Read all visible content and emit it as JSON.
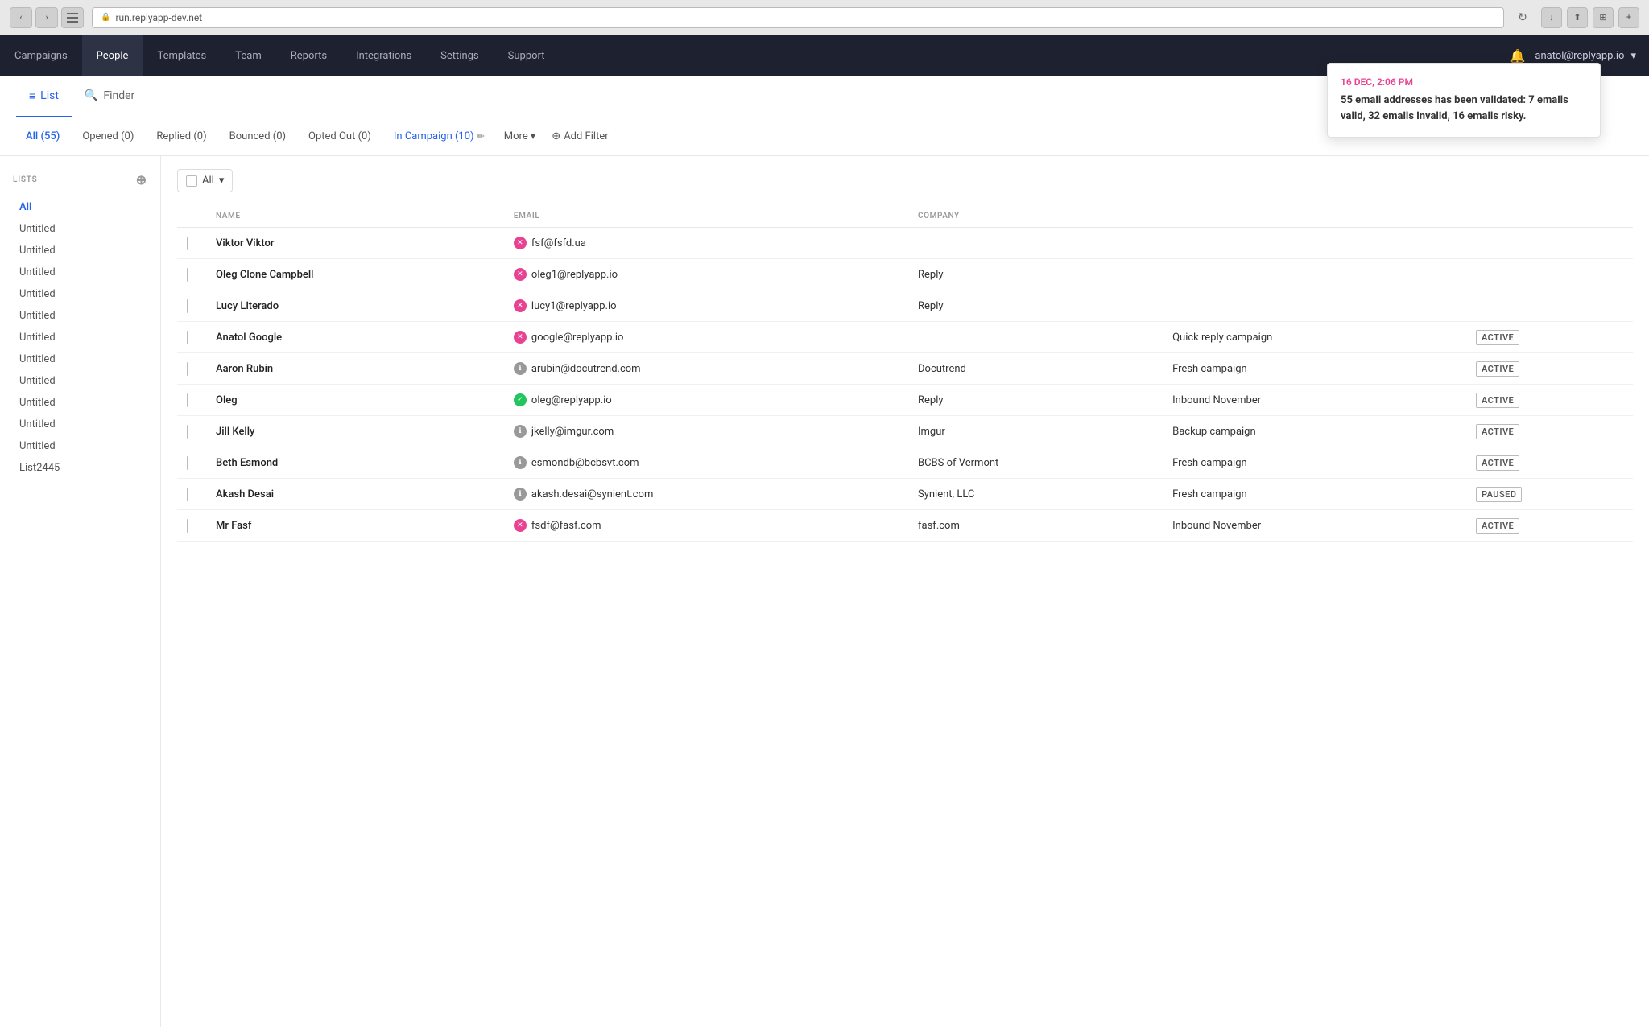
{
  "browser": {
    "url": "run.replyapp-dev.net",
    "lock_symbol": "🔒"
  },
  "nav": {
    "items": [
      {
        "label": "Campaigns",
        "active": false
      },
      {
        "label": "People",
        "active": true
      },
      {
        "label": "Templates",
        "active": false
      },
      {
        "label": "Team",
        "active": false
      },
      {
        "label": "Reports",
        "active": false
      },
      {
        "label": "Integrations",
        "active": false
      },
      {
        "label": "Settings",
        "active": false
      },
      {
        "label": "Support",
        "active": false
      }
    ],
    "user": "anatol@replyapp.io"
  },
  "sub_nav": {
    "list_label": "List",
    "finder_label": "Finder"
  },
  "filter_tabs": {
    "all": "All (55)",
    "opened": "Opened (0)",
    "replied": "Replied (0)",
    "bounced": "Bounced (0)",
    "opted_out": "Opted Out (0)",
    "in_campaign": "In Campaign (10)",
    "more": "More",
    "add": "Add Filter"
  },
  "sidebar": {
    "section_label": "LISTS",
    "items": [
      {
        "label": "All",
        "active": true
      },
      {
        "label": "Untitled",
        "active": false
      },
      {
        "label": "Untitled",
        "active": false
      },
      {
        "label": "Untitled",
        "active": false
      },
      {
        "label": "Untitled",
        "active": false
      },
      {
        "label": "Untitled",
        "active": false
      },
      {
        "label": "Untitled",
        "active": false
      },
      {
        "label": "Untitled",
        "active": false
      },
      {
        "label": "Untitled",
        "active": false
      },
      {
        "label": "Untitled",
        "active": false
      },
      {
        "label": "Untitled",
        "active": false
      },
      {
        "label": "Untitled",
        "active": false
      },
      {
        "label": "List2445",
        "active": false
      }
    ]
  },
  "table": {
    "columns": [
      "",
      "NAME",
      "EMAIL",
      "COMPANY",
      "",
      ""
    ],
    "rows": [
      {
        "name": "Viktor Viktor",
        "email": "fsf@fsfd.ua",
        "email_status": "invalid",
        "company": "",
        "campaign": "",
        "status": ""
      },
      {
        "name": "Oleg Clone Campbell",
        "email": "oleg1@replyapp.io",
        "email_status": "invalid",
        "company": "Reply",
        "campaign": "",
        "status": ""
      },
      {
        "name": "Lucy Literado",
        "email": "lucy1@replyapp.io",
        "email_status": "invalid",
        "company": "Reply",
        "campaign": "",
        "status": ""
      },
      {
        "name": "Anatol Google",
        "email": "google@replyapp.io",
        "email_status": "invalid",
        "company": "",
        "campaign": "Quick reply campaign",
        "status": "ACTIVE"
      },
      {
        "name": "Aaron Rubin",
        "email": "arubin@docutrend.com",
        "email_status": "risky",
        "company": "Docutrend",
        "campaign": "Fresh campaign",
        "status": "ACTIVE"
      },
      {
        "name": "Oleg",
        "email": "oleg@replyapp.io",
        "email_status": "valid",
        "company": "Reply",
        "campaign": "Inbound November",
        "status": "ACTIVE"
      },
      {
        "name": "Jill Kelly",
        "email": "jkelly@imgur.com",
        "email_status": "risky",
        "company": "Imgur",
        "campaign": "Backup campaign",
        "status": "ACTIVE"
      },
      {
        "name": "Beth Esmond",
        "email": "esmondb@bcbsvt.com",
        "email_status": "risky",
        "company": "BCBS of Vermont",
        "campaign": "Fresh campaign",
        "status": "ACTIVE"
      },
      {
        "name": "Akash Desai",
        "email": "akash.desai@synient.com",
        "email_status": "risky",
        "company": "Synient, LLC",
        "campaign": "Fresh campaign",
        "status": "PAUSED"
      },
      {
        "name": "Mr Fasf",
        "email": "fsdf@fasf.com",
        "email_status": "invalid",
        "company": "fasf.com",
        "campaign": "Inbound November",
        "status": "ACTIVE"
      }
    ]
  },
  "notification": {
    "time": "16 DEC, 2:06 PM",
    "message_bold": "55 email addresses has been validated: 7 emails valid, 32 emails invalid, 16 emails risky."
  },
  "select_all": {
    "label": "All",
    "chevron": "▾"
  }
}
